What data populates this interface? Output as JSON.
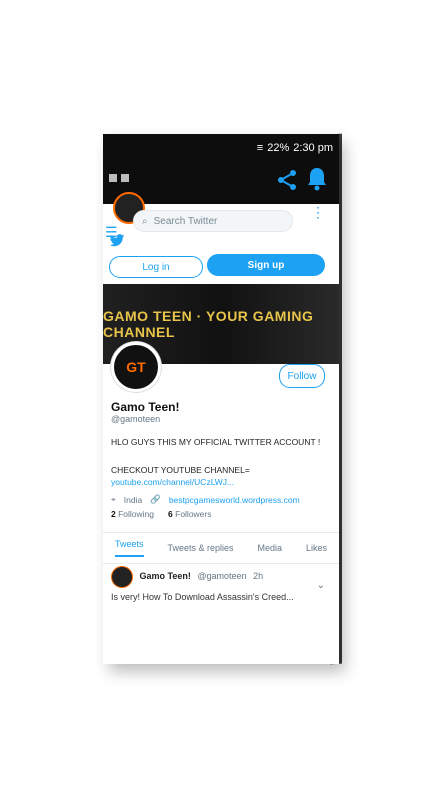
{
  "status": {
    "signal": "≡",
    "battery": "22%",
    "time": "2:30 pm"
  },
  "icons": {
    "share": "share-icon",
    "bell": "bell-icon",
    "menu": "menu-icon",
    "kebab": "kebab-menu-icon",
    "bird": "twitter-bird-icon",
    "search": "search-icon",
    "chevron": "chevron-down-icon"
  },
  "search": {
    "placeholder": "Search Twitter"
  },
  "buttons": {
    "login": "Log in",
    "signup": "Sign up",
    "follow": "Follow"
  },
  "profile": {
    "banner_text": "GAMO TEEN · YOUR GAMING CHANNEL",
    "name": "Gamo Teen!",
    "handle": "@gamoteen",
    "bio_line1": "HLO GUYS THIS MY OFFICIAL TWITTER ACCOUNT !",
    "bio_line2": "CHECKOUT YOUTUBE CHANNEL=",
    "bio_link": "youtube.com/channel/UCzLWJ...",
    "location": "India",
    "website": "bestpcgamesworld.wordpress.com",
    "following_count": "2",
    "following_label": "Following",
    "followers_count": "6",
    "followers_label": "Followers"
  },
  "tabs": [
    "Tweets",
    "Tweets & replies",
    "Media",
    "Likes"
  ],
  "tweet": {
    "name": "Gamo Teen!",
    "handle": "@gamoteen",
    "time": "2h",
    "preview": "Is very! How To Download Assassin's Creed..."
  },
  "colors": {
    "accent": "#1da1f2",
    "dark": "#0d0d0d",
    "brand": "#ff6a00"
  }
}
